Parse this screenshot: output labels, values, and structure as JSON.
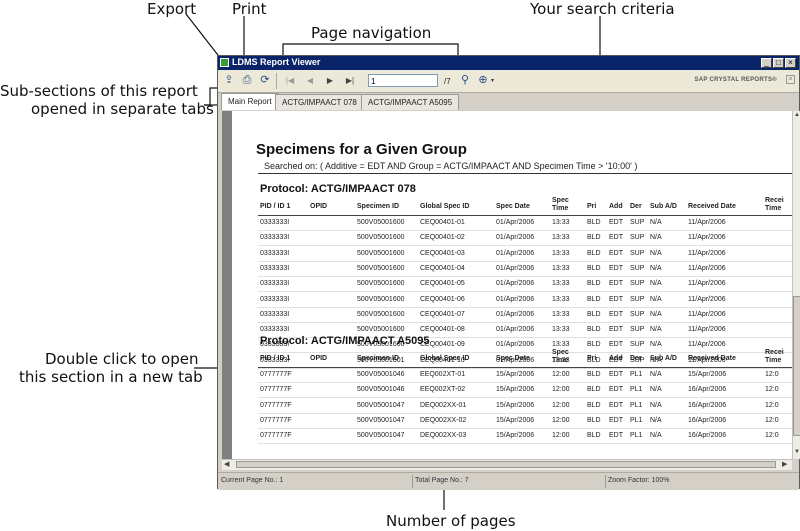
{
  "callouts": {
    "export": "Export",
    "print": "Print",
    "page_navigation": "Page navigation",
    "search_criteria": "Your search criteria",
    "subsections_line1": "Sub-sections of this report",
    "subsections_line2": "opened in separate tabs",
    "double_click_line1": "Double click to open",
    "double_click_line2": "this section in a new tab",
    "number_of_pages": "Number of pages"
  },
  "window": {
    "title": "LDMS Report Viewer",
    "brand": "SAP CRYSTAL REPORTS®",
    "page_input": "1",
    "page_total": "/7",
    "colors": {
      "titlebar": "#0a246a",
      "chrome": "#d4d0c8"
    }
  },
  "tabs": [
    "Main Report",
    "ACTG/IMPAACT 078",
    "ACTG/IMPAACT A5095"
  ],
  "report": {
    "title": "Specimens for a Given Group",
    "searched_on": "Searched on: ( Additive = EDT  AND  Group = ACTG/IMPAACT  AND  Specimen Time > '10:00' )",
    "columns": [
      "PID / ID 1",
      "OPID",
      "Specimen ID",
      "Global Spec ID",
      "Spec Date",
      "Spec Time",
      "Pri",
      "Add",
      "Der",
      "Sub A/D",
      "Received Date",
      "Recei Time"
    ],
    "sections": [
      {
        "protocol": "Protocol:  ACTG/IMPAACT 078",
        "rows": [
          [
            "0333333I",
            "",
            "500V05001600",
            "CEQ00401-01",
            "01/Apr/2006",
            "13:33",
            "BLD",
            "EDT",
            "SUP",
            "N/A",
            "11/Apr/2006",
            ""
          ],
          [
            "0333333I",
            "",
            "500V05001600",
            "CEQ00401-02",
            "01/Apr/2006",
            "13:33",
            "BLD",
            "EDT",
            "SUP",
            "N/A",
            "11/Apr/2006",
            ""
          ],
          [
            "0333333I",
            "",
            "500V05001600",
            "CEQ00401-03",
            "01/Apr/2006",
            "13:33",
            "BLD",
            "EDT",
            "SUP",
            "N/A",
            "11/Apr/2006",
            ""
          ],
          [
            "0333333I",
            "",
            "500V05001600",
            "CEQ00401-04",
            "01/Apr/2006",
            "13:33",
            "BLD",
            "EDT",
            "SUP",
            "N/A",
            "11/Apr/2006",
            ""
          ],
          [
            "0333333I",
            "",
            "500V05001600",
            "CEQ00401-05",
            "01/Apr/2006",
            "13:33",
            "BLD",
            "EDT",
            "SUP",
            "N/A",
            "11/Apr/2006",
            ""
          ],
          [
            "0333333I",
            "",
            "500V05001600",
            "CEQ00401-06",
            "01/Apr/2006",
            "13:33",
            "BLD",
            "EDT",
            "SUP",
            "N/A",
            "11/Apr/2006",
            ""
          ],
          [
            "0333333I",
            "",
            "500V05001600",
            "CEQ00401-07",
            "01/Apr/2006",
            "13:33",
            "BLD",
            "EDT",
            "SUP",
            "N/A",
            "11/Apr/2006",
            ""
          ],
          [
            "0333333I",
            "",
            "500V05001600",
            "CEQ00401-08",
            "01/Apr/2006",
            "13:33",
            "BLD",
            "EDT",
            "SUP",
            "N/A",
            "11/Apr/2006",
            ""
          ],
          [
            "0333333I",
            "",
            "500V05001600",
            "CEQ00401-09",
            "01/Apr/2006",
            "13:33",
            "BLD",
            "EDT",
            "SUP",
            "N/A",
            "11/Apr/2006",
            ""
          ],
          [
            "0333333I",
            "",
            "500V05001601",
            "CEQ00401-10",
            "01/Apr/2006",
            "13:33",
            "BLD",
            "EDT",
            "SUP",
            "N/A",
            "11/Apr/2006",
            ""
          ]
        ]
      },
      {
        "protocol": "Protocol:  ACTG/IMPAACT A5095",
        "rows": [
          [
            "0777777F",
            "",
            "500V05001046",
            "EEQ002XT-01",
            "15/Apr/2006",
            "12:00",
            "BLD",
            "EDT",
            "PL1",
            "N/A",
            "15/Apr/2006",
            "12:0"
          ],
          [
            "0777777F",
            "",
            "500V05001046",
            "EEQ002XT-02",
            "15/Apr/2006",
            "12:00",
            "BLD",
            "EDT",
            "PL1",
            "N/A",
            "16/Apr/2006",
            "12:0"
          ],
          [
            "0777777F",
            "",
            "500V05001047",
            "DEQ002XX-01",
            "15/Apr/2006",
            "12:00",
            "BLD",
            "EDT",
            "PL1",
            "N/A",
            "16/Apr/2006",
            "12:0"
          ],
          [
            "0777777F",
            "",
            "500V05001047",
            "DEQ002XX-02",
            "15/Apr/2006",
            "12:00",
            "BLD",
            "EDT",
            "PL1",
            "N/A",
            "16/Apr/2006",
            "12:0"
          ],
          [
            "0777777F",
            "",
            "500V05001047",
            "DEQ002XX-03",
            "15/Apr/2006",
            "12:00",
            "BLD",
            "EDT",
            "PL1",
            "N/A",
            "16/Apr/2006",
            "12:0"
          ]
        ]
      }
    ]
  },
  "status": {
    "current_page": "Current Page No.: 1",
    "total_page": "Total Page No.: 7",
    "zoom": "Zoom Factor: 100%"
  }
}
